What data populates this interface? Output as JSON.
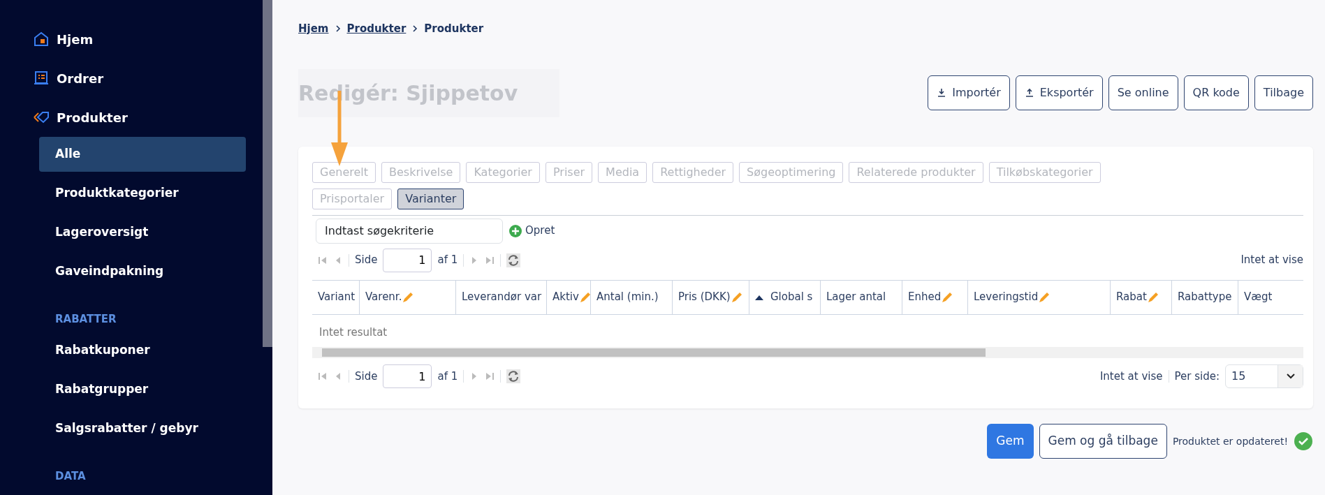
{
  "sidebar": {
    "items": [
      {
        "label": "Hjem",
        "kind": "main",
        "selected": false
      },
      {
        "label": "Ordrer",
        "kind": "main",
        "selected": false
      },
      {
        "label": "Produkter",
        "kind": "main",
        "selected": false
      },
      {
        "label": "Alle",
        "kind": "sub",
        "selected": true
      },
      {
        "label": "Produktkategorier",
        "kind": "sub",
        "selected": false
      },
      {
        "label": "Lageroversigt",
        "kind": "sub",
        "selected": false
      },
      {
        "label": "Gaveindpakning",
        "kind": "sub",
        "selected": false
      },
      {
        "label": "RABATTER",
        "kind": "heading"
      },
      {
        "label": "Rabatkuponer",
        "kind": "sub",
        "selected": false
      },
      {
        "label": "Rabatgrupper",
        "kind": "sub",
        "selected": false
      },
      {
        "label": "Salgsrabatter / gebyr",
        "kind": "sub",
        "selected": false
      },
      {
        "label": "DATA",
        "kind": "heading"
      }
    ]
  },
  "breadcrumb": [
    {
      "label": "Hjem",
      "link": true
    },
    {
      "label": "Produkter",
      "link": true
    },
    {
      "label": "Produkter",
      "link": false
    }
  ],
  "title": "Redigér: Sjippetov",
  "actions": [
    {
      "label": "Importér"
    },
    {
      "label": "Eksportér"
    },
    {
      "label": "Se online"
    },
    {
      "label": "QR kode"
    },
    {
      "label": "Tilbage"
    }
  ],
  "tabs": [
    {
      "label": "Generelt",
      "selected": false
    },
    {
      "label": "Beskrivelse",
      "selected": false
    },
    {
      "label": "Kategorier",
      "selected": false
    },
    {
      "label": "Priser",
      "selected": false
    },
    {
      "label": "Media",
      "selected": false
    },
    {
      "label": "Rettigheder",
      "selected": false
    },
    {
      "label": "Søgeoptimering",
      "selected": false
    },
    {
      "label": "Relaterede produkter",
      "selected": false
    },
    {
      "label": "Tilkøbskategorier",
      "selected": false
    },
    {
      "label": "Prisportaler",
      "selected": false
    },
    {
      "label": "Varianter",
      "selected": true
    }
  ],
  "search": {
    "value": "Indtast søgekriterie"
  },
  "create_label": "Opret",
  "pager_top": {
    "page_label": "Side",
    "page": "1",
    "of": "af 1",
    "info": "Intet at vise"
  },
  "table": {
    "columns": [
      {
        "label": "Variant",
        "editable": false,
        "sorted": false
      },
      {
        "label": "Varenr.",
        "editable": true,
        "sorted": false
      },
      {
        "label": "Leverandør var",
        "editable": false,
        "sorted": false
      },
      {
        "label": "Aktiv",
        "editable": true,
        "sorted": false
      },
      {
        "label": "Antal (min.)",
        "editable": false,
        "sorted": false
      },
      {
        "label": "Pris (DKK)",
        "editable": true,
        "sorted": false
      },
      {
        "label": "Global s",
        "editable": false,
        "sorted": true
      },
      {
        "label": "Lager antal",
        "editable": false,
        "sorted": false
      },
      {
        "label": "Enhed",
        "editable": true,
        "sorted": false
      },
      {
        "label": "Leveringstid",
        "editable": true,
        "sorted": false
      },
      {
        "label": "Rabat",
        "editable": true,
        "sorted": false
      },
      {
        "label": "Rabattype",
        "editable": false,
        "sorted": false
      },
      {
        "label": "Vægt",
        "editable": false,
        "sorted": false
      }
    ],
    "empty": "Intet resultat"
  },
  "pager_bottom": {
    "page_label": "Side",
    "page": "1",
    "of": "af 1",
    "info": "Intet at vise",
    "per_page_label": "Per side:",
    "per_page": "15"
  },
  "footer": {
    "save": "Gem",
    "save_back": "Gem og gå tilbage",
    "status": "Produktet er opdateret!"
  }
}
